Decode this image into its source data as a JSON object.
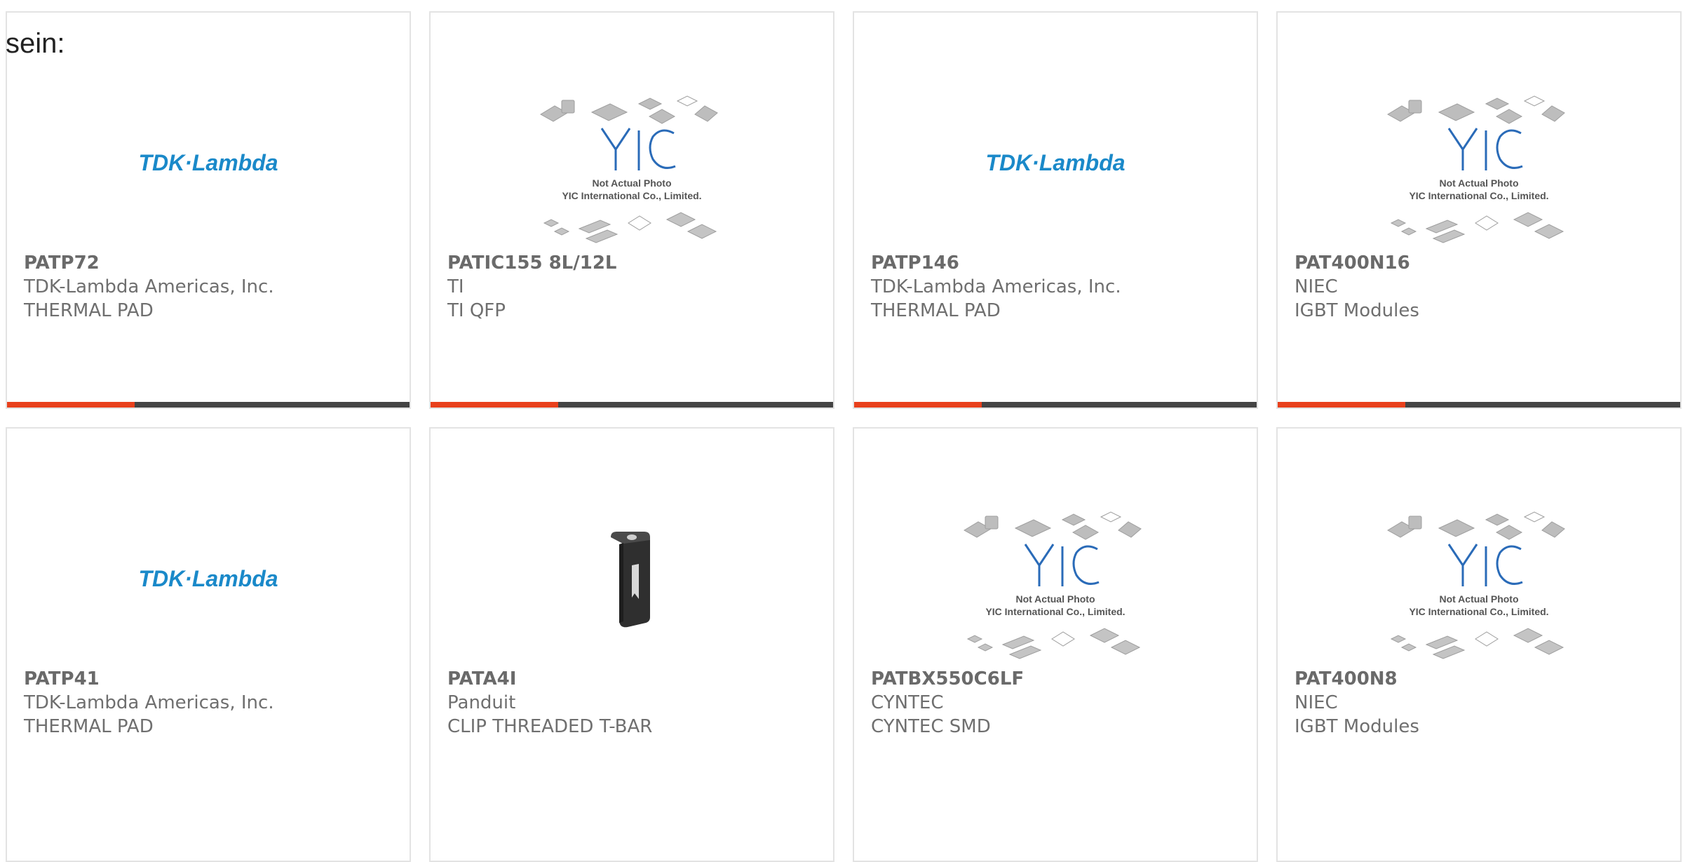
{
  "heading": "sein:",
  "brand_colors": {
    "accent_bar": "#e8401c",
    "bar_rest": "#444444",
    "tdk_logo": "#1a89c9",
    "yic_logo": "#2a6bb8"
  },
  "cards": [
    {
      "part": "PATP72",
      "manufacturer": "TDK-Lambda Americas, Inc.",
      "description": "THERMAL PAD",
      "image": "tdk-lambda-logo",
      "logo_text": "TDK·Lambda"
    },
    {
      "part": "PATIC155 8L/12L",
      "manufacturer": "TI",
      "description": "TI QFP",
      "image": "yic-not-actual-photo",
      "placeholder_line1": "Not Actual Photo",
      "placeholder_line2": "YIC International Co., Limited."
    },
    {
      "part": "PATP146",
      "manufacturer": "TDK-Lambda Americas, Inc.",
      "description": "THERMAL PAD",
      "image": "tdk-lambda-logo",
      "logo_text": "TDK·Lambda"
    },
    {
      "part": "PAT400N16",
      "manufacturer": "NIEC",
      "description": "IGBT Modules",
      "image": "yic-not-actual-photo",
      "placeholder_line1": "Not Actual Photo",
      "placeholder_line2": "YIC International Co., Limited."
    },
    {
      "part": "PATP41",
      "manufacturer": "TDK-Lambda Americas, Inc.",
      "description": "THERMAL PAD",
      "image": "tdk-lambda-logo",
      "logo_text": "TDK·Lambda"
    },
    {
      "part": "PATA4I",
      "manufacturer": "Panduit",
      "description": "CLIP THREADED T-BAR",
      "image": "clip-photo"
    },
    {
      "part": "PATBX550C6LF",
      "manufacturer": "CYNTEC",
      "description": "CYNTEC SMD",
      "image": "yic-not-actual-photo",
      "placeholder_line1": "Not Actual Photo",
      "placeholder_line2": "YIC International Co., Limited."
    },
    {
      "part": "PAT400N8",
      "manufacturer": "NIEC",
      "description": "IGBT Modules",
      "image": "yic-not-actual-photo",
      "placeholder_line1": "Not Actual Photo",
      "placeholder_line2": "YIC International Co., Limited."
    }
  ]
}
